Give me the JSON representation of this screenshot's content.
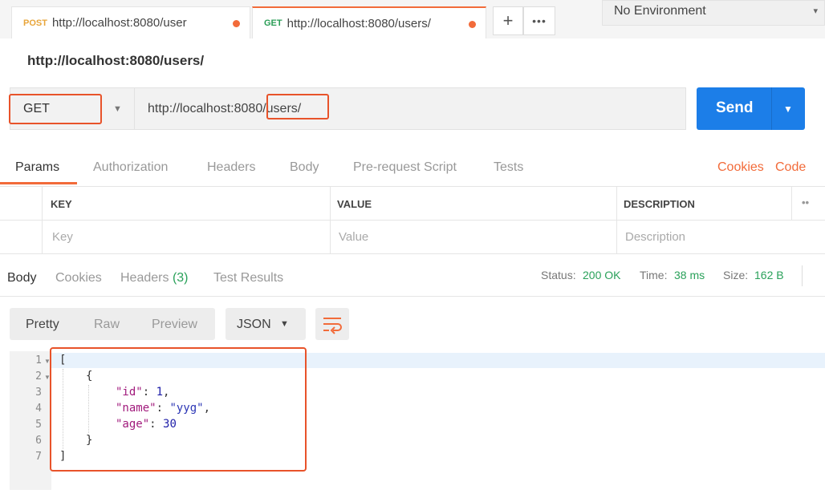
{
  "tabs": [
    {
      "method": "POST",
      "url": "http://localhost:8080/user"
    },
    {
      "method": "GET",
      "url": "http://localhost:8080/users/"
    }
  ],
  "tab_controls": {
    "add_icon": "+",
    "more_icon": "•••"
  },
  "environment": {
    "label": "No Environment",
    "caret": "▾"
  },
  "request": {
    "title": "http://localhost:8080/users/",
    "method": "GET",
    "url": "http://localhost:8080/users/",
    "send_label": "Send",
    "send_caret": "▼",
    "method_caret": "▼"
  },
  "request_tabs": {
    "items": [
      "Params",
      "Authorization",
      "Headers",
      "Body",
      "Pre-request Script",
      "Tests"
    ],
    "active": "Params",
    "cookies_link": "Cookies",
    "code_link": "Code"
  },
  "params_table": {
    "headers": [
      "KEY",
      "VALUE",
      "DESCRIPTION"
    ],
    "more_icon": "••",
    "placeholders": [
      "Key",
      "Value",
      "Description"
    ]
  },
  "response_tabs": {
    "body": "Body",
    "cookies": "Cookies",
    "headers_label": "Headers",
    "headers_count": "(3)",
    "test_results": "Test Results"
  },
  "response_status": {
    "status_label": "Status:",
    "status_value": "200 OK",
    "time_label": "Time:",
    "time_value": "38 ms",
    "size_label": "Size:",
    "size_value": "162 B"
  },
  "format": {
    "options": [
      "Pretty",
      "Raw",
      "Preview"
    ],
    "active": "Pretty",
    "type": "JSON",
    "type_caret": "▼"
  },
  "response_body": {
    "line_numbers": [
      "1",
      "2",
      "3",
      "4",
      "5",
      "6",
      "7"
    ],
    "open_bracket": "[",
    "open_brace": "{",
    "fields": [
      {
        "key": "\"id\"",
        "value": "1",
        "sep": ","
      },
      {
        "key": "\"name\"",
        "value": "\"yyg\"",
        "sep": ","
      },
      {
        "key": "\"age\"",
        "value": "30",
        "sep": ""
      }
    ],
    "close_brace": "}",
    "close_bracket": "]"
  },
  "colors": {
    "accent": "#f26b3a",
    "send": "#1c7ee8",
    "status_green": "#2aa15a",
    "highlight_box": "#e8532a"
  }
}
